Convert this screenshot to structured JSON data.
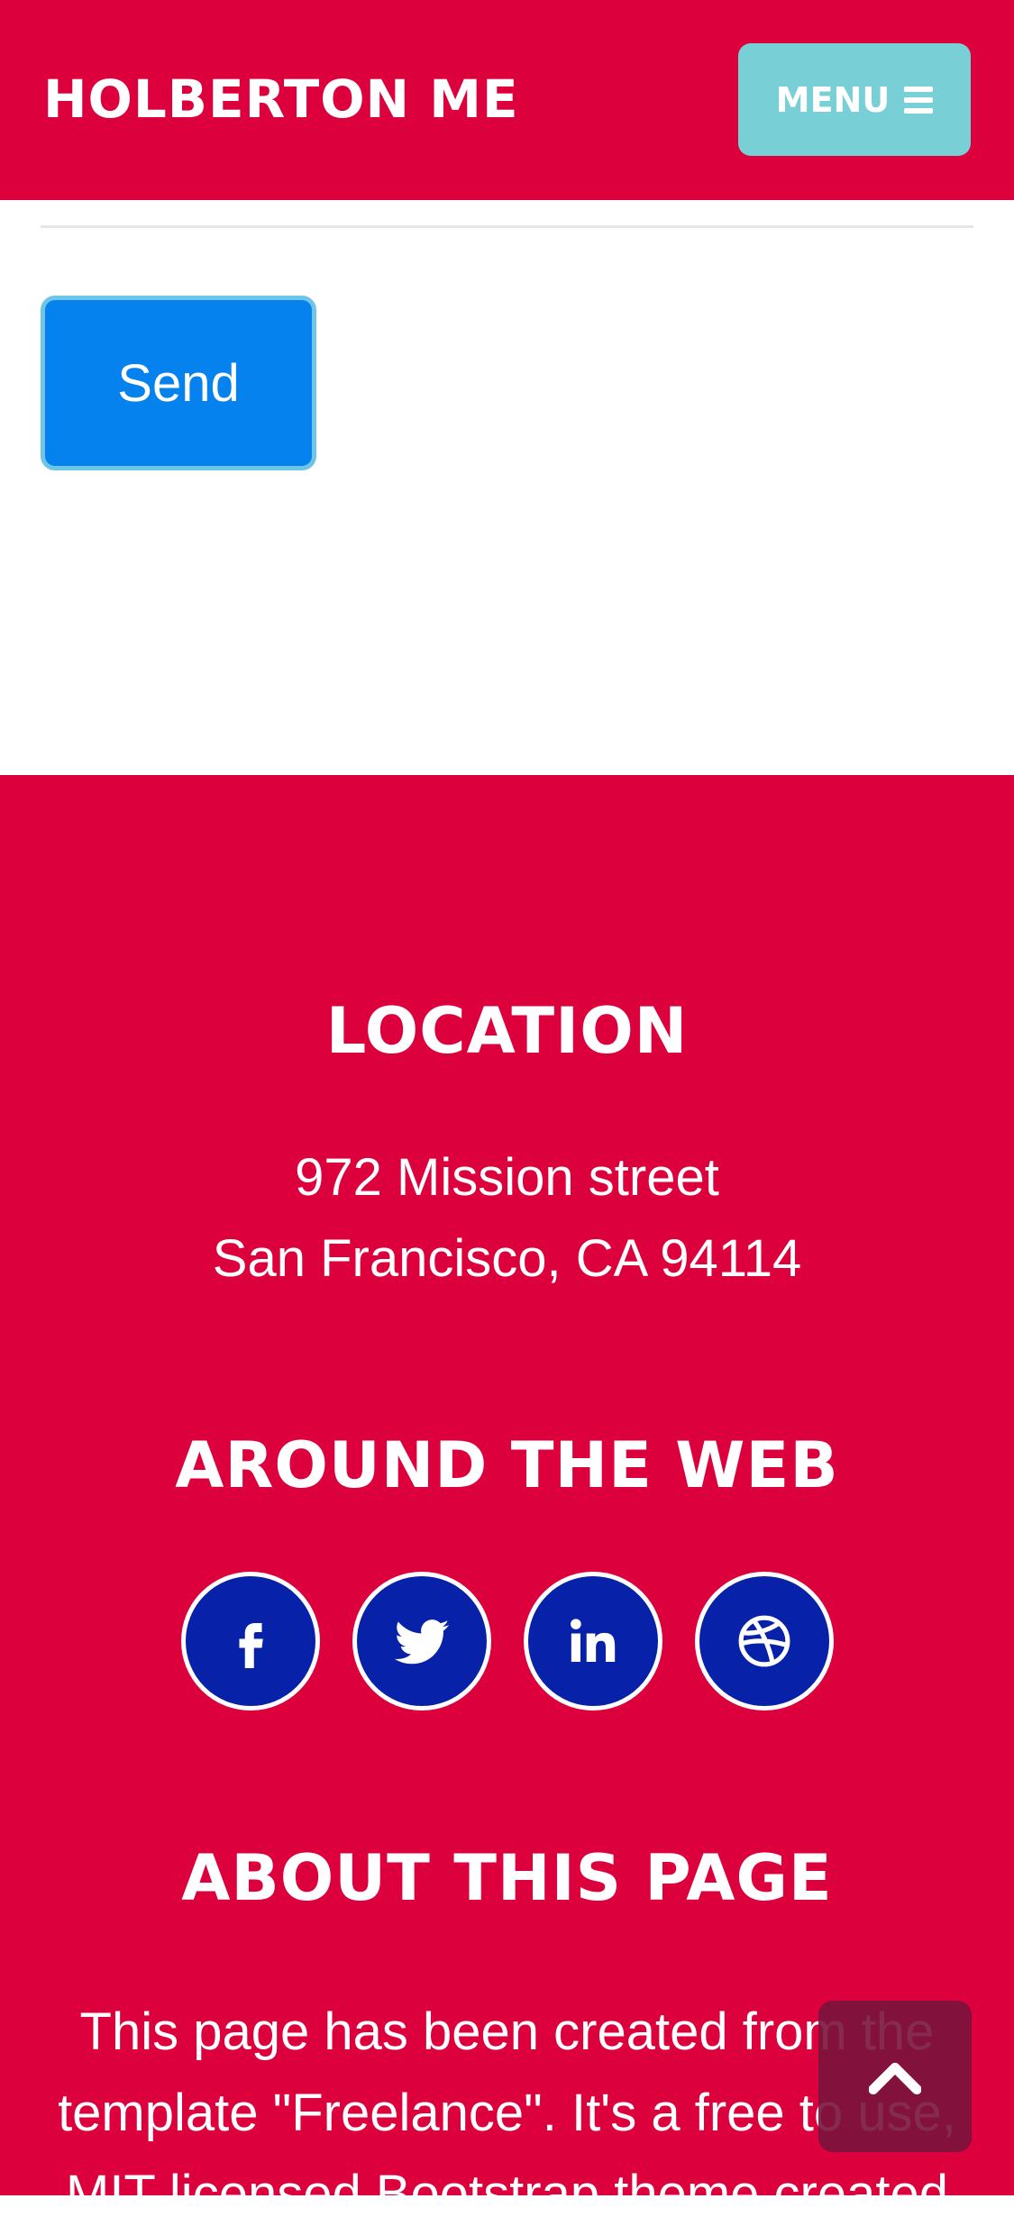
{
  "navbar": {
    "brand": "HOLBERTON ME",
    "menu_label": "MENU"
  },
  "form": {
    "send_label": "Send"
  },
  "footer": {
    "location_heading": "LOCATION",
    "address_line1": "972 Mission street",
    "address_line2": "San Francisco, CA 94114",
    "web_heading": "AROUND THE WEB",
    "socials": [
      {
        "name": "facebook",
        "icon": "facebook-icon"
      },
      {
        "name": "twitter",
        "icon": "twitter-icon"
      },
      {
        "name": "linkedin",
        "icon": "linkedin-icon"
      },
      {
        "name": "dribbble",
        "icon": "dribbble-icon"
      }
    ],
    "about_heading": "ABOUT THIS PAGE",
    "about_line1": "This page has been created from the",
    "about_line2": "template \"Freelance\". It's a free to use,",
    "about_line3": "MIT licensed Bootstrap theme created"
  },
  "colors": {
    "primary_red": "#dc003c",
    "menu_teal": "#78cfd6",
    "send_blue": "#0582ee",
    "social_navy": "#0721a8",
    "scroll_top_bg": "#78143c"
  }
}
